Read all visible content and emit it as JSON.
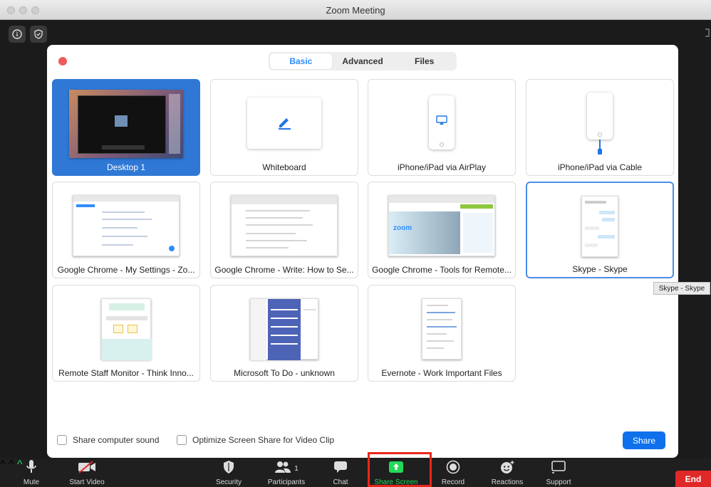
{
  "window": {
    "title": "Zoom Meeting"
  },
  "dialog": {
    "tabs": [
      {
        "label": "Basic",
        "active": true
      },
      {
        "label": "Advanced",
        "active": false
      },
      {
        "label": "Files",
        "active": false
      }
    ],
    "sources": [
      {
        "label": "Desktop 1",
        "selected": true
      },
      {
        "label": "Whiteboard"
      },
      {
        "label": "iPhone/iPad via AirPlay"
      },
      {
        "label": "iPhone/iPad via Cable"
      },
      {
        "label": "Google Chrome - My Settings - Zo..."
      },
      {
        "label": "Google Chrome - Write: How to Se..."
      },
      {
        "label": "Google Chrome - Tools for Remote..."
      },
      {
        "label": "Skype - Skype",
        "hovered": true
      },
      {
        "label": "Remote Staff Monitor - Think Inno..."
      },
      {
        "label": "Microsoft To Do - unknown"
      },
      {
        "label": "Evernote - Work Important Files"
      }
    ],
    "options": {
      "share_sound": "Share computer sound",
      "optimize_video": "Optimize Screen Share for Video Clip"
    },
    "share_label": "Share",
    "tooltip": "Skype - Skype"
  },
  "toolbar": {
    "mute": "Mute",
    "start_video": "Start Video",
    "security": "Security",
    "participants": "Participants",
    "participants_count": "1",
    "chat": "Chat",
    "share_screen": "Share Screen",
    "record": "Record",
    "reactions": "Reactions",
    "support": "Support",
    "end": "End"
  },
  "colors": {
    "accent": "#2d8cff",
    "selected_tile": "#2f78d6",
    "share_green": "#23d959",
    "end_red": "#e02828",
    "highlight": "#e8271c"
  }
}
